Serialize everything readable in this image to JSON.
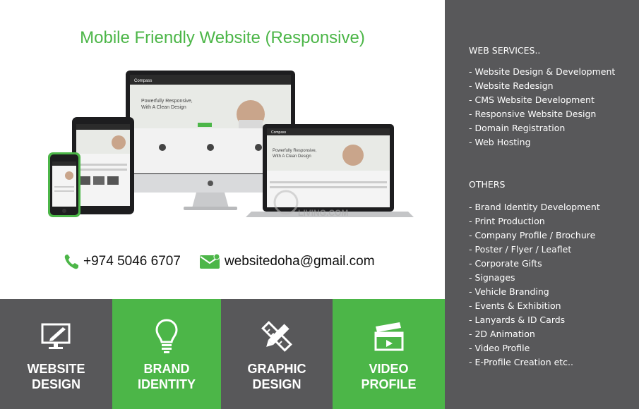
{
  "headline": "Mobile Friendly Website (Responsive)",
  "device_screen": {
    "brand": "Compass",
    "hero_line1": "Powerfully Responsive,",
    "hero_line2": "With A Clean Design"
  },
  "watermark": "LIVING.COM",
  "contact": {
    "phone": "+974 5046 6707",
    "email": "websitedoha@gmail.com"
  },
  "tiles": [
    {
      "label": "WEBSITE\nDESIGN",
      "icon": "monitor-pen-icon"
    },
    {
      "label": "BRAND\nIDENTITY",
      "icon": "lightbulb-icon"
    },
    {
      "label": "GRAPHIC\nDESIGN",
      "icon": "pencil-ruler-icon"
    },
    {
      "label": "VIDEO\nPROFILE",
      "icon": "clapperboard-icon"
    }
  ],
  "colors": {
    "green": "#4cb648",
    "gray": "#58585a"
  },
  "web_services": {
    "title": "WEB SERVICES..",
    "items": [
      "- Website Design & Development",
      "- Website Redesign",
      "- CMS Website Development",
      "- Responsive Website Design",
      "- Domain Registration",
      "- Web Hosting"
    ]
  },
  "others": {
    "title": "OTHERS",
    "items": [
      "- Brand Identity Development",
      "- Print Production",
      "- Company Profile / Brochure",
      "- Poster / Flyer / Leaflet",
      "- Corporate Gifts",
      "- Signages",
      "- Vehicle Branding",
      "- Events & Exhibition",
      "- Lanyards & ID Cards",
      "- 2D Animation",
      "- Video Profile",
      "- E-Profile Creation etc.."
    ]
  }
}
